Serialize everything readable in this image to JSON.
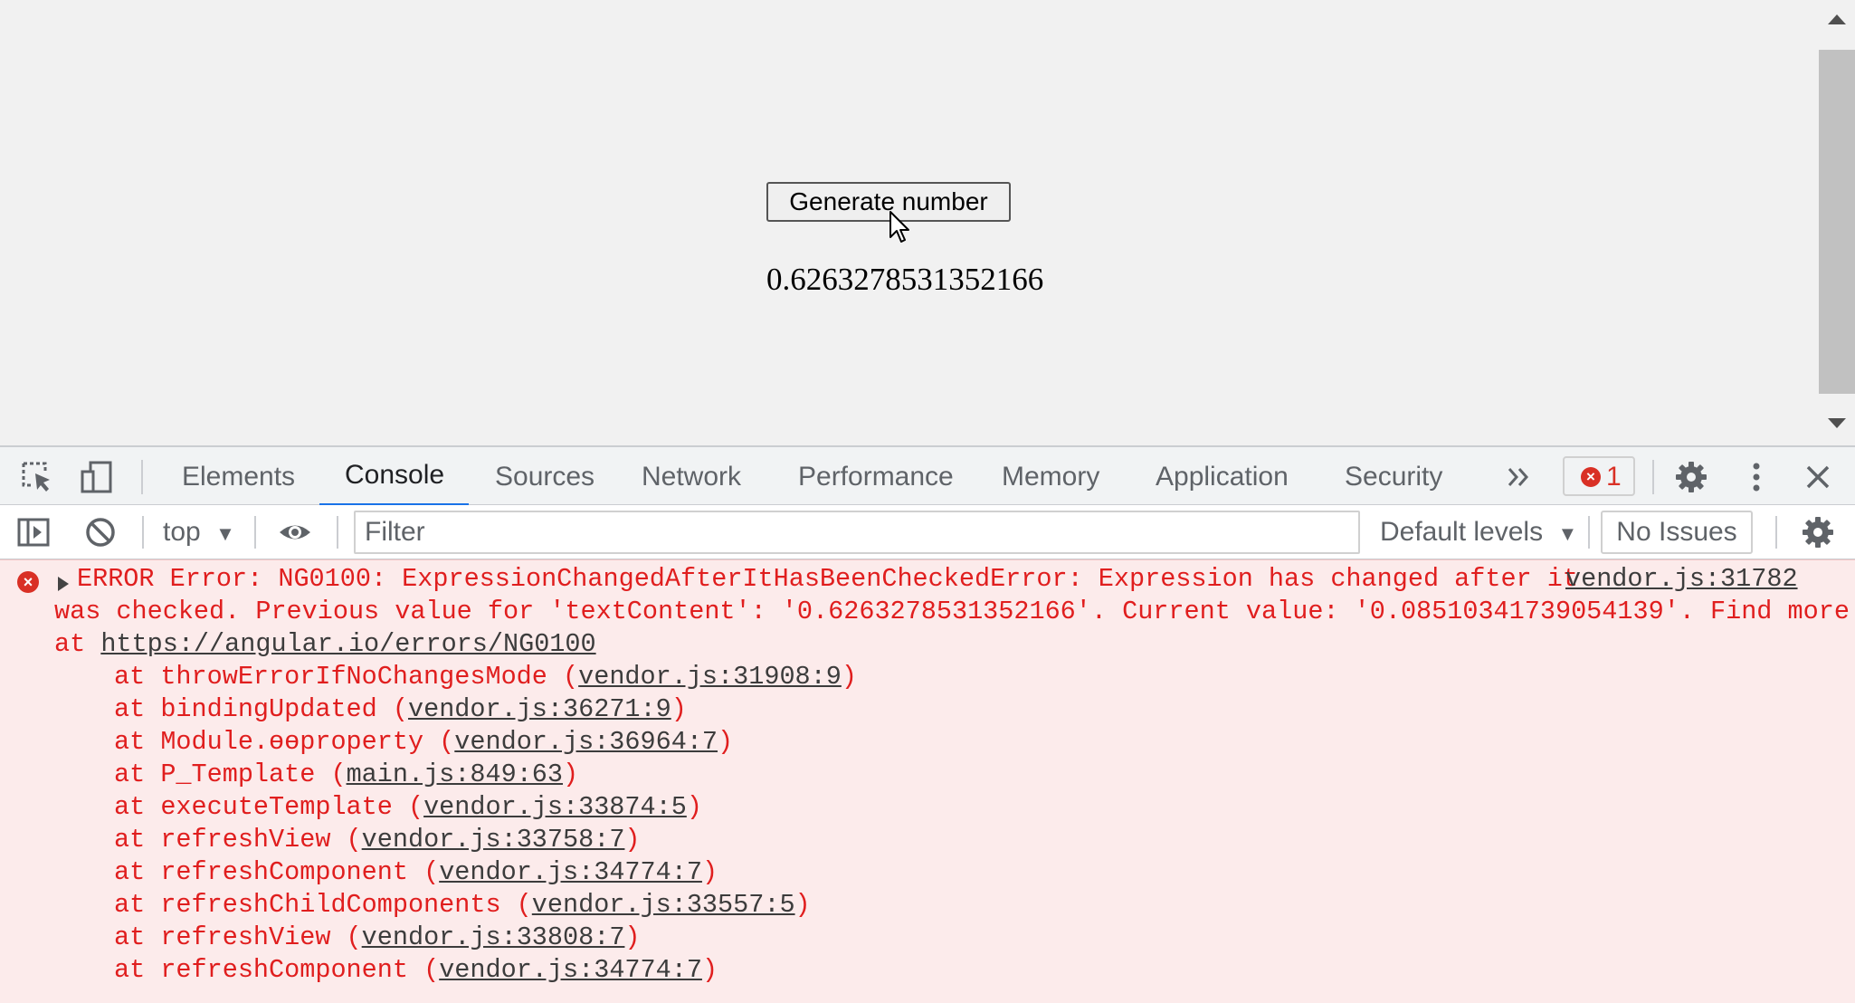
{
  "page": {
    "button_label": "Generate number",
    "number": "0.6263278531352166"
  },
  "devtools": {
    "tabs": [
      "Elements",
      "Console",
      "Sources",
      "Network",
      "Performance",
      "Memory",
      "Application",
      "Security"
    ],
    "active_tab": "Console",
    "more_tabs_icon": "chevron-double-right-icon",
    "error_count": "1",
    "toolbar": {
      "context": "top",
      "filter_placeholder": "Filter",
      "levels": "Default levels",
      "issues": "No Issues"
    },
    "error": {
      "line1": "ERROR Error: NG0100: ExpressionChangedAfterItHasBeenCheckedError: Expression has changed after it",
      "source_link": "vendor.js:31782",
      "line2": "was checked. Previous value for 'textContent': '0.6263278531352166'. Current value: '0.08510341739054139'. Find more",
      "line3_prefix": "at ",
      "line3_link": "https://angular.io/errors/NG0100",
      "stack": [
        {
          "fn": "throwErrorIfNoChangesMode",
          "loc": "vendor.js:31908:9"
        },
        {
          "fn": "bindingUpdated",
          "loc": "vendor.js:36271:9"
        },
        {
          "fn": "Module.ɵɵproperty",
          "loc": "vendor.js:36964:7"
        },
        {
          "fn": "P_Template",
          "loc": "main.js:849:63"
        },
        {
          "fn": "executeTemplate",
          "loc": "vendor.js:33874:5"
        },
        {
          "fn": "refreshView",
          "loc": "vendor.js:33758:7"
        },
        {
          "fn": "refreshComponent",
          "loc": "vendor.js:34774:7"
        },
        {
          "fn": "refreshChildComponents",
          "loc": "vendor.js:33557:5"
        },
        {
          "fn": "refreshView",
          "loc": "vendor.js:33808:7"
        },
        {
          "fn": "refreshComponent",
          "loc": "vendor.js:34774:7"
        }
      ]
    }
  },
  "colors": {
    "error_red": "#e01e1e",
    "active_tab_accent": "#1a73e8",
    "console_error_bg": "#fcebeb"
  }
}
